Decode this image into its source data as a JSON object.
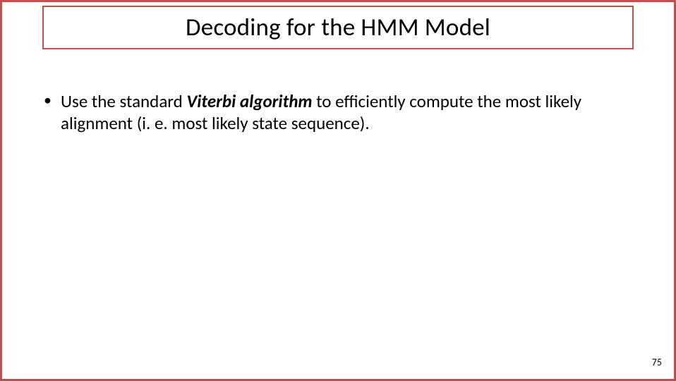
{
  "slide": {
    "title": "Decoding for the HMM Model",
    "bullets": [
      {
        "pre": "Use the standard ",
        "emph": "Viterbi algorithm",
        "post": " to efficiently compute the most likely alignment (i. e. most likely state sequence)."
      }
    ],
    "page_number": "75"
  }
}
